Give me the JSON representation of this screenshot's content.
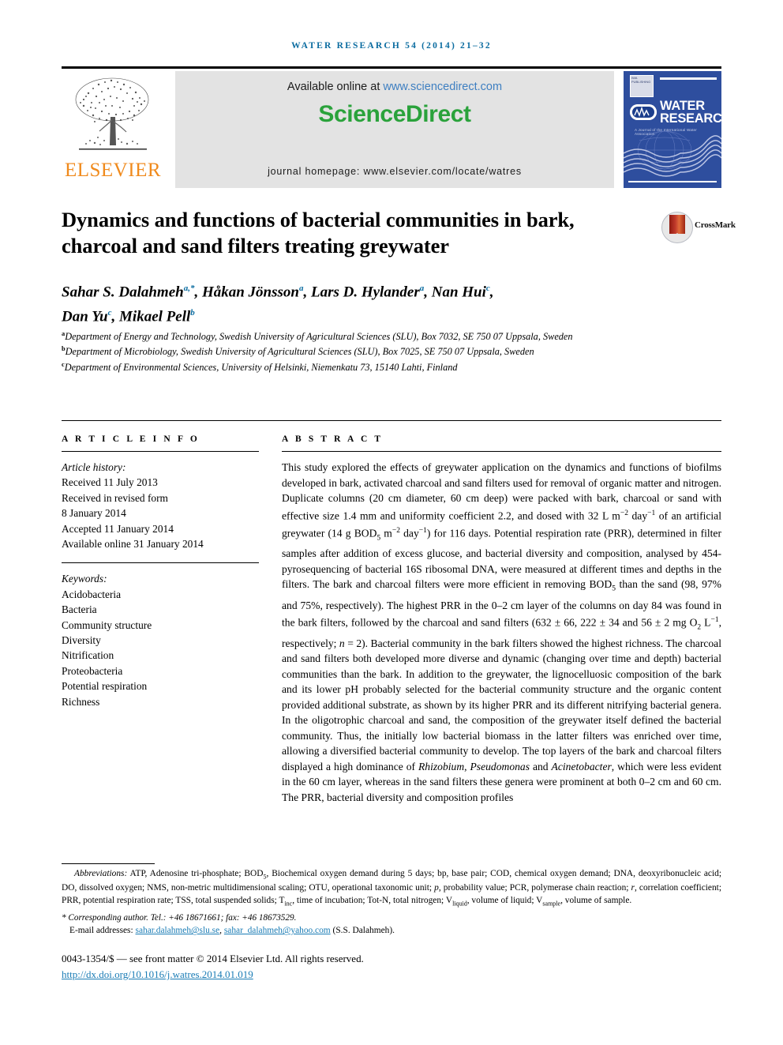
{
  "running_head": "WATER RESEARCH 54 (2014) 21–32",
  "masthead": {
    "publisher_name": "ELSEVIER",
    "available_text": "Available online at ",
    "sciencedirect_url": "www.sciencedirect.com",
    "sciencedirect_logo": "ScienceDirect",
    "journal_homepage": "journal homepage: www.elsevier.com/locate/watres",
    "cover": {
      "title_line1": "WATER",
      "title_line2": "RESEARCH",
      "subtitle": "A Journal of the International Water Association",
      "society_logo": "IWA",
      "small_logo_text": "IWA PUBLISHING"
    }
  },
  "article": {
    "title": "Dynamics and functions of bacterial communities in bark, charcoal and sand filters treating greywater",
    "crossmark_label": "CrossMark",
    "authors_line1_parts": [
      {
        "name": "Sahar S. Dalahmeh",
        "sup": "a,*"
      },
      {
        "name": "Håkan Jönsson",
        "sup": "a"
      },
      {
        "name": "Lars D. Hylander",
        "sup": "a"
      },
      {
        "name": "Nan Hui",
        "sup": "c"
      }
    ],
    "authors_line2_parts": [
      {
        "name": "Dan Yu",
        "sup": "c"
      },
      {
        "name": "Mikael Pell",
        "sup": "b"
      }
    ],
    "affiliations": [
      {
        "marker": "a",
        "text": "Department of Energy and Technology, Swedish University of Agricultural Sciences (SLU), Box 7032, SE 750 07 Uppsala, Sweden"
      },
      {
        "marker": "b",
        "text": "Department of Microbiology, Swedish University of Agricultural Sciences (SLU), Box 7025, SE 750 07 Uppsala, Sweden"
      },
      {
        "marker": "c",
        "text": "Department of Environmental Sciences, University of Helsinki, Niemenkatu 73, 15140 Lahti, Finland"
      }
    ]
  },
  "article_info": {
    "heading": "A R T I C L E   I N F O",
    "history_label": "Article history:",
    "history": [
      "Received 11 July 2013",
      "Received in revised form",
      "8 January 2014",
      "Accepted 11 January 2014",
      "Available online 31 January 2014"
    ],
    "keywords_label": "Keywords:",
    "keywords": [
      "Acidobacteria",
      "Bacteria",
      "Community structure",
      "Diversity",
      "Nitrification",
      "Proteobacteria",
      "Potential respiration",
      "Richness"
    ]
  },
  "abstract": {
    "heading": "A B S T R A C T",
    "text_html": "This study explored the effects of greywater application on the dynamics and functions of biofilms developed in bark, activated charcoal and sand filters used for removal of organic matter and nitrogen. Duplicate columns (20 cm diameter, 60 cm deep) were packed with bark, charcoal or sand with effective size 1.4 mm and uniformity coefficient 2.2, and dosed with 32 L m<sup>−2</sup> day<sup>−1</sup> of an artificial greywater (14 g BOD<sub>5</sub> m<sup>−2</sup> day<sup>−1</sup>) for 116 days. Potential respiration rate (PRR), determined in filter samples after addition of excess glucose, and bacterial diversity and composition, analysed by 454-pyrosequencing of bacterial 16S ribosomal DNA, were measured at different times and depths in the filters. The bark and charcoal filters were more efficient in removing BOD<sub>5</sub> than the sand (98, 97% and 75%, respectively). The highest PRR in the 0–2 cm layer of the columns on day 84 was found in the bark filters, followed by the charcoal and sand filters (632 ± 66, 222 ± 34 and 56 ± 2 mg O<sub>2</sub> L<sup>−1</sup>, respectively; <i>n</i> = 2). Bacterial community in the bark filters showed the highest richness. The charcoal and sand filters both developed more diverse and dynamic (changing over time and depth) bacterial communities than the bark. In addition to the greywater, the lignocelluosic composition of the bark and its lower pH probably selected for the bacterial community structure and the organic content provided additional substrate, as shown by its higher PRR and its different nitrifying bacterial genera. In the oligotrophic charcoal and sand, the composition of the greywater itself defined the bacterial community. Thus, the initially low bacterial biomass in the latter filters was enriched over time, allowing a diversified bacterial community to develop. The top layers of the bark and charcoal filters displayed a high dominance of <i>Rhizobium</i>, <i>Pseudomonas</i> and <i>Acinetobacter</i>, which were less evident in the 60 cm layer, whereas in the sand filters these genera were prominent at both 0–2 cm and 60 cm. The PRR, bacterial diversity and composition profiles"
  },
  "footnotes": {
    "abbreviations_label": "Abbreviations:",
    "abbreviations_html": " ATP, Adenosine tri-phosphate; BOD<sub>5</sub>, Biochemical oxygen demand during 5 days; bp, base pair; COD, chemical oxygen demand; DNA, deoxyribonucleic acid; DO, dissolved oxygen; NMS, non-metric multidimensional scaling; OTU, operational taxonomic unit; <i>p</i>, probability value; PCR, polymerase chain reaction; <i>r</i>, correlation coefficient; PRR, potential respiration rate; TSS, total suspended solids; T<sub>inc</sub>, time of incubation; Tot-N, total nitrogen; V<sub>liquid</sub>, volume of liquid; V<sub>sample</sub>, volume of sample.",
    "corresponding_html": "<span class=\"corr-star\">*</span> <i>Corresponding author</i>. Tel.: +46 18671661; fax: +46 18673529.",
    "email_label": "E-mail addresses: ",
    "email_1": "sahar.dalahmeh@slu.se",
    "email_2": "sahar_dalahmeh@yahoo.com",
    "email_suffix": " (S.S. Dalahmeh)."
  },
  "imprint": {
    "copyright": "0043-1354/$ — see front matter © 2014 Elsevier Ltd. All rights reserved.",
    "doi": "http://dx.doi.org/10.1016/j.watres.2014.01.019"
  }
}
